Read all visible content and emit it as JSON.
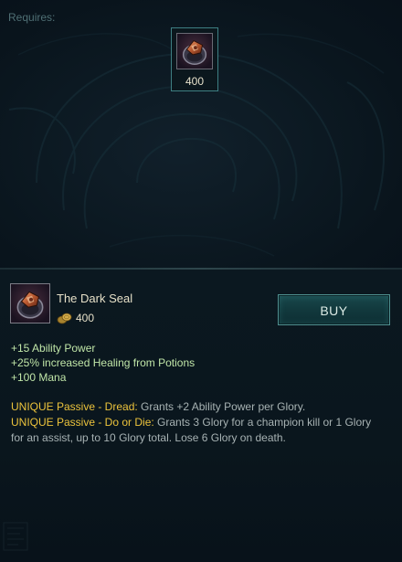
{
  "requires": {
    "label": "Requires:",
    "items": [
      {
        "icon": "dark-seal-icon",
        "cost": "400"
      }
    ]
  },
  "item": {
    "name": "The Dark Seal",
    "cost": "400",
    "icon": "dark-seal-icon",
    "buy_label": "BUY",
    "stats": [
      "+15 Ability Power",
      "+25% increased Healing from Potions",
      "+100 Mana"
    ],
    "passives": [
      {
        "title": "UNIQUE Passive - Dread:",
        "text": "Grants +2 Ability Power per Glory."
      },
      {
        "title": "UNIQUE Passive - Do or Die:",
        "text": "Grants 3 Glory for a champion kill or 1 Glory for an assist, up to 10 Glory total. Lose 6 Glory on death."
      }
    ]
  },
  "colors": {
    "passive_title": "#ecc33c",
    "stat_text": "#c0e6a8",
    "body_text": "#a7b2b3",
    "gold_text": "#e6e0c8",
    "accent_border": "#3e7f83"
  }
}
